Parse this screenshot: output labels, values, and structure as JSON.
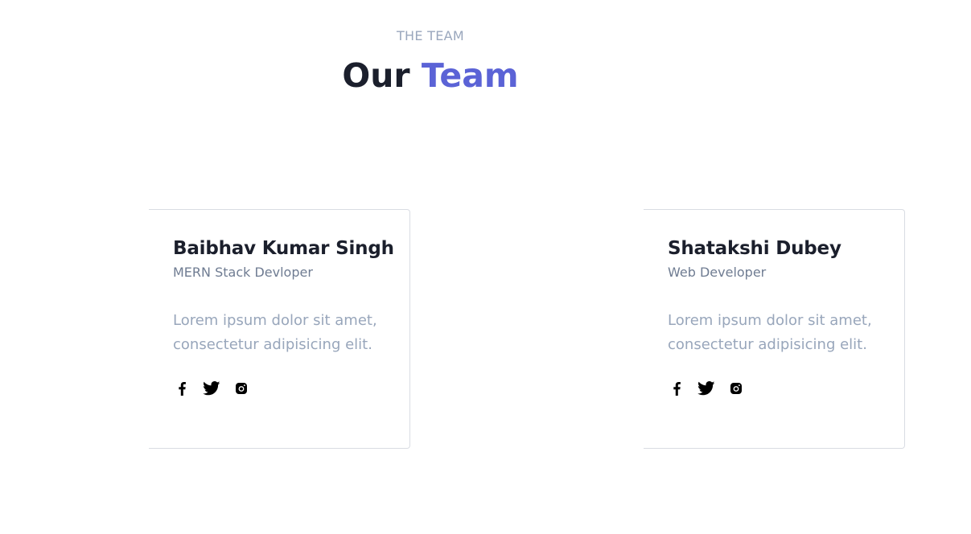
{
  "header": {
    "eyebrow": "THE TEAM",
    "title_part1": "Our",
    "title_part2": "Team",
    "accent_color": "#5b63d6"
  },
  "members": [
    {
      "name": "Baibhav Kumar Singh",
      "role": "MERN Stack Devloper",
      "bio": "Lorem ipsum dolor sit amet, consectetur adipisicing elit.",
      "socials": [
        "facebook-icon",
        "twitter-icon",
        "instagram-icon"
      ]
    },
    {
      "name": "Shatakshi Dubey",
      "role": "Web Developer",
      "bio": "Lorem ipsum dolor sit amet, consectetur adipisicing elit.",
      "socials": [
        "facebook-icon",
        "twitter-icon",
        "instagram-icon"
      ]
    }
  ]
}
